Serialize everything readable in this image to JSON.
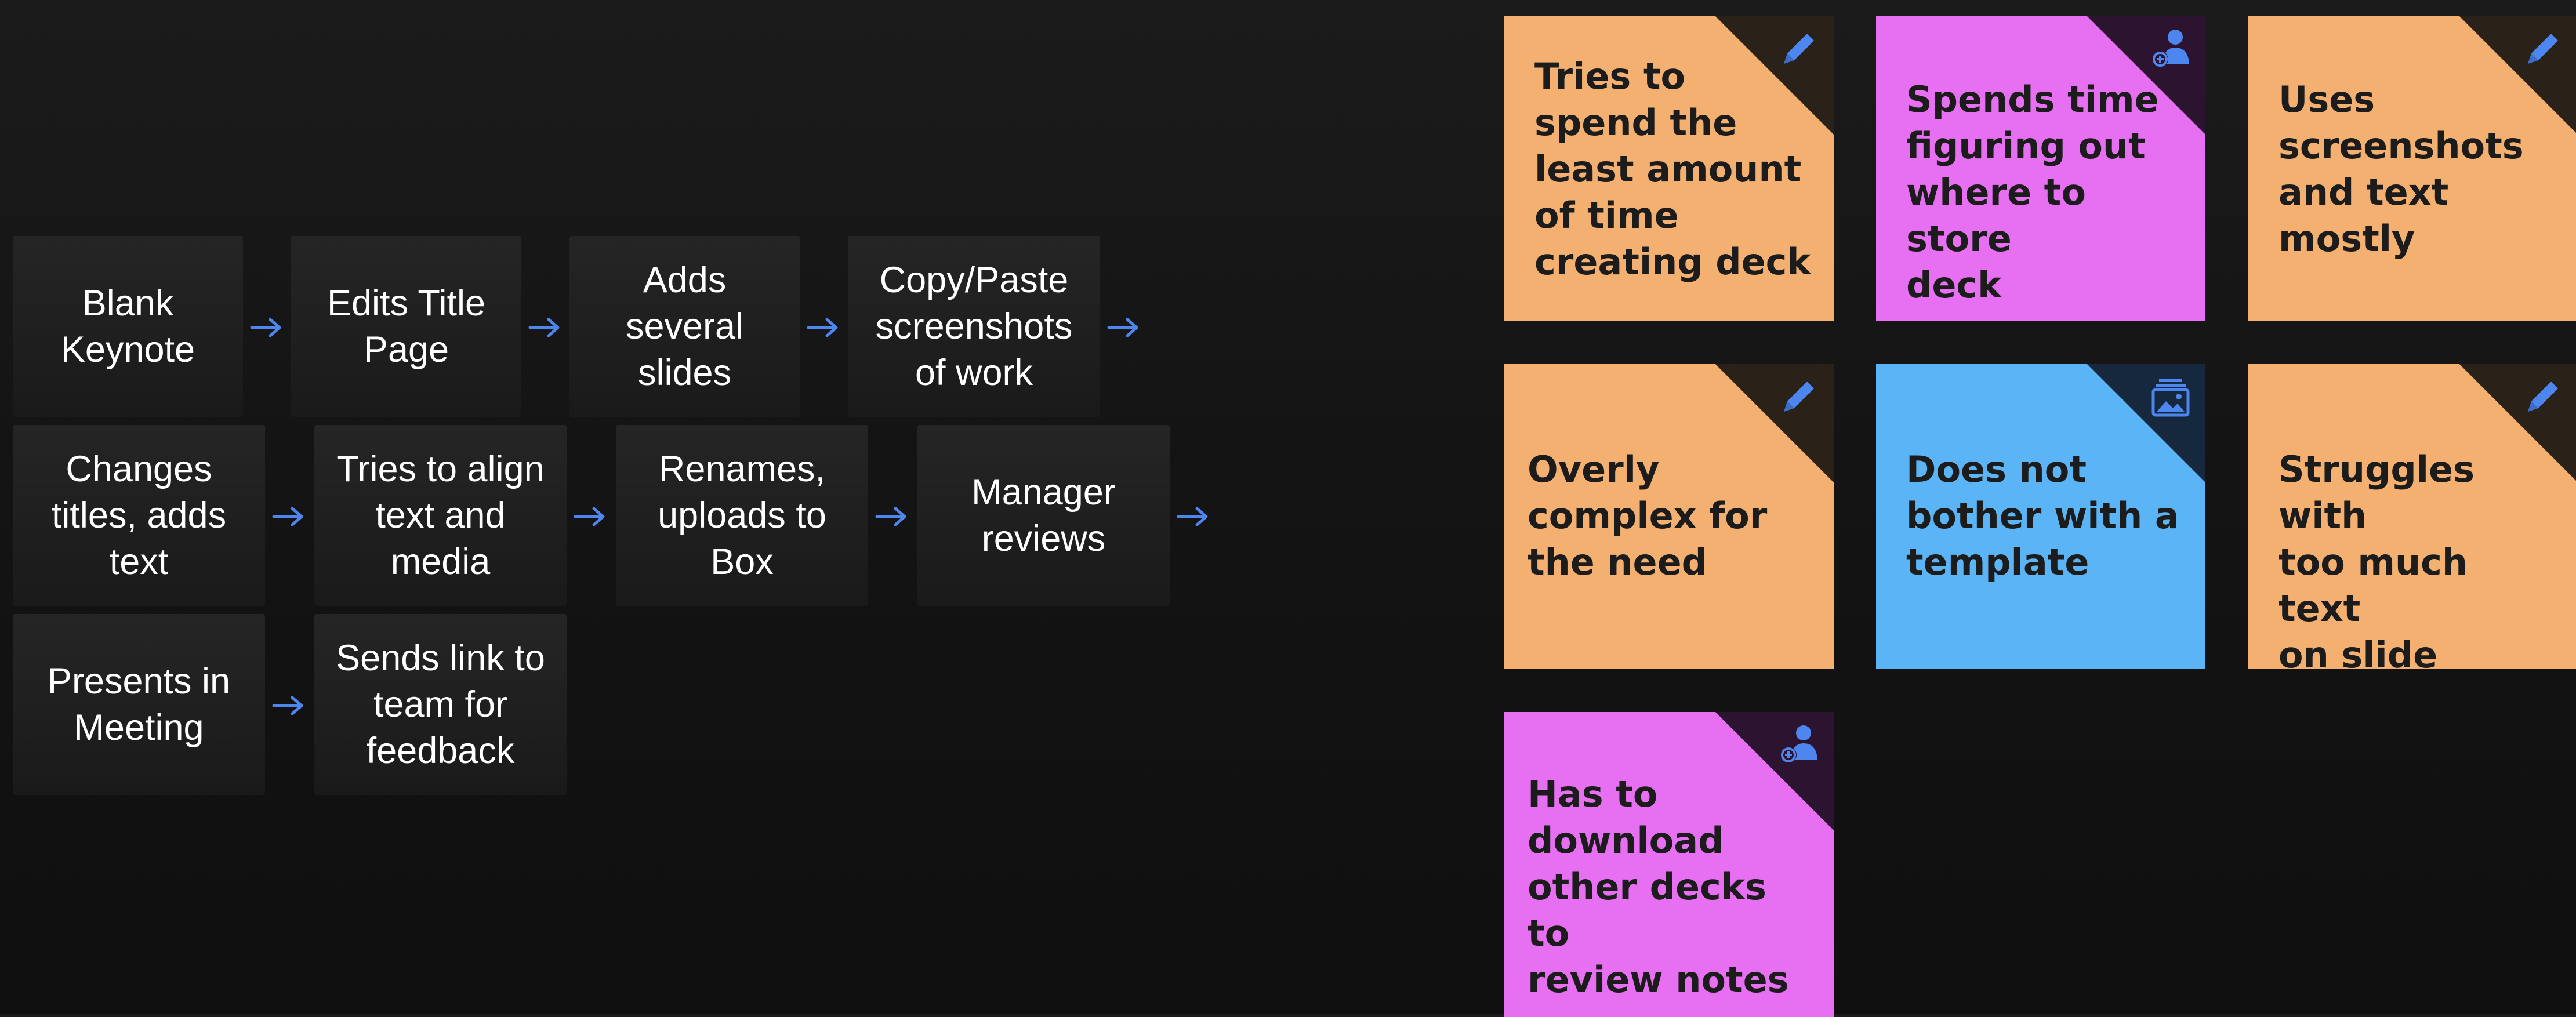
{
  "colors": {
    "background": "#141414",
    "step_background": "#202020",
    "arrow": "#4d86ee",
    "note_orange": "#f3b070",
    "note_pink": "#e66ff2",
    "note_blue": "#5ab4f6",
    "fold_orange": "#2a2119",
    "fold_pink": "#2c1430",
    "fold_blue": "#15283d",
    "icon": "#4d86ee"
  },
  "flow": {
    "rows": [
      {
        "steps": [
          {
            "label": "Blank\nKeynote"
          },
          {
            "label": "Edits Title\nPage"
          },
          {
            "label": "Adds\nseveral\nslides"
          },
          {
            "label": "Copy/Paste\nscreenshots\nof work"
          }
        ]
      },
      {
        "steps": [
          {
            "label": "Changes\ntitles, adds\ntext"
          },
          {
            "label": "Tries to align\ntext and\nmedia"
          },
          {
            "label": "Renames,\nuploads to\nBox"
          },
          {
            "label": "Manager\nreviews"
          }
        ]
      },
      {
        "steps": [
          {
            "label": "Presents in\nMeeting"
          },
          {
            "label": "Sends link to\nteam for\nfeedback"
          }
        ]
      }
    ]
  },
  "notes": [
    {
      "text": "Tries to\nspend the\nleast amount\nof time\ncreating deck",
      "color": "orange",
      "icon": "pencil-icon"
    },
    {
      "text": "Spends time\nfiguring out\nwhere to store\ndeck",
      "color": "pink",
      "icon": "add-person-icon"
    },
    {
      "text": "Uses\nscreenshots\nand text\nmostly",
      "color": "orange",
      "icon": "pencil-icon"
    },
    {
      "text": "Overly\ncomplex for\nthe need",
      "color": "orange",
      "icon": "pencil-icon"
    },
    {
      "text": "Does not\nbother with a\ntemplate",
      "color": "blue",
      "icon": "image-stack-icon"
    },
    {
      "text": "Struggles with\ntoo much text\non slide",
      "color": "orange",
      "icon": "pencil-icon"
    },
    {
      "text": "Has to\ndownload\nother decks to\nreview notes",
      "color": "pink",
      "icon": "add-person-icon"
    }
  ]
}
